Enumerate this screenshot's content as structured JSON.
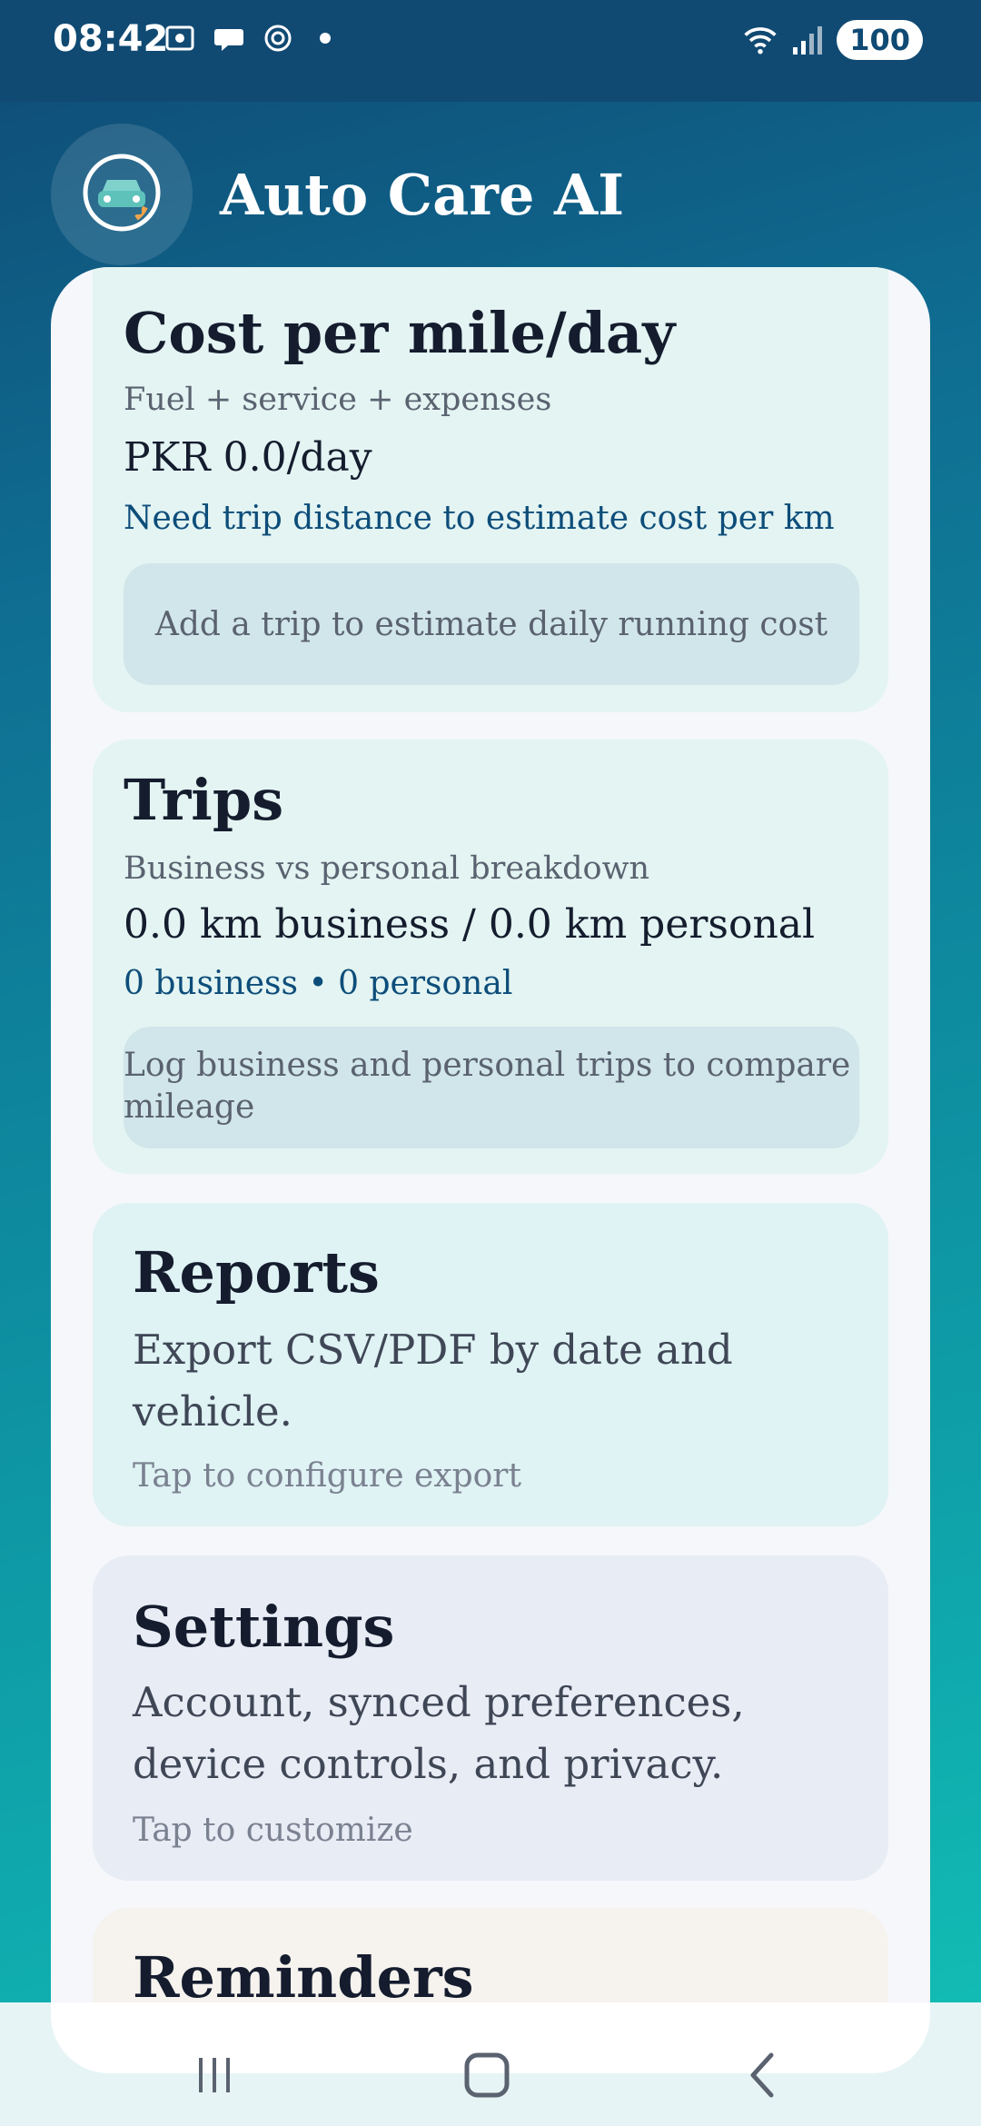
{
  "status_bar": {
    "time": "08:42",
    "battery": "100",
    "icons_left": [
      "screenshot-icon",
      "chat-bubble-icon",
      "openai-icon"
    ],
    "icons_right": [
      "wifi-icon",
      "signal-icon"
    ]
  },
  "header": {
    "title": "Auto Care AI",
    "logo_icon": "car-gauge-icon"
  },
  "cards": {
    "cost": {
      "title": "Cost per mile/day",
      "subtitle": "Fuel + service + expenses",
      "value": "PKR 0.0/day",
      "note": "Need trip distance to estimate cost per km",
      "hint": "Add a trip to estimate daily running cost"
    },
    "trips": {
      "title": "Trips",
      "subtitle": "Business vs personal breakdown",
      "value": "0.0 km business / 0.0 km personal",
      "note": "0 business • 0 personal",
      "hint": "Log business and personal trips to compare mileage"
    },
    "reports": {
      "title": "Reports",
      "description": "Export CSV/PDF by date and vehicle.",
      "action": "Tap to configure export"
    },
    "settings": {
      "title": "Settings",
      "description": "Account, synced preferences, device controls, and privacy.",
      "action": "Tap to customize"
    },
    "reminders": {
      "title": "Reminders"
    }
  },
  "nav": {
    "icons": [
      "recent-apps-icon",
      "home-icon",
      "back-icon"
    ]
  },
  "colors": {
    "header_bg": "#104a73",
    "accent_text": "#0d4d7a",
    "gradient_bottom": "#13c2b6"
  }
}
